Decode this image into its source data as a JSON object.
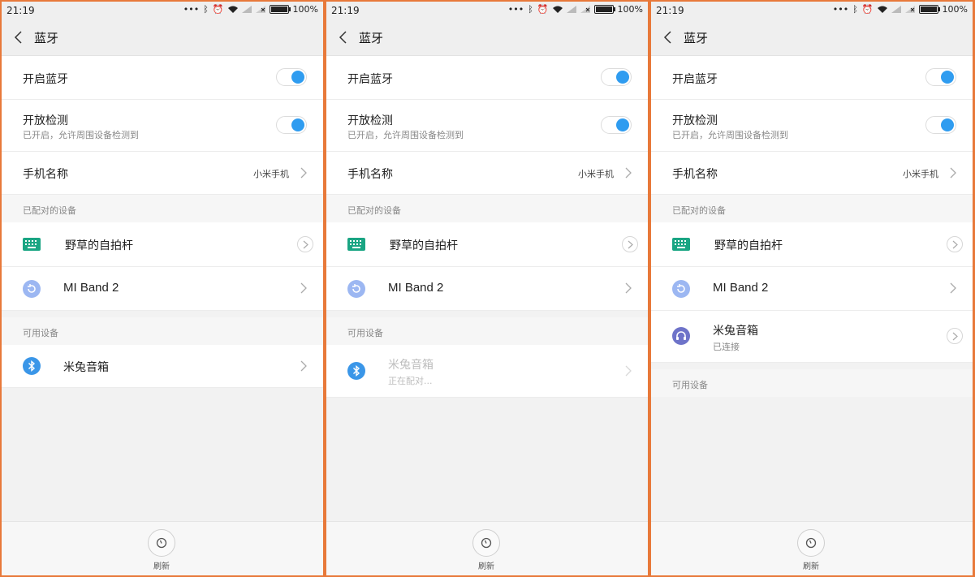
{
  "status": {
    "time": "21:19",
    "battery": "100%"
  },
  "title": "蓝牙",
  "settings": {
    "bluetooth_on_label": "开启蓝牙",
    "discoverable_label": "开放检测",
    "discoverable_sub": "已开启，允许周围设备检测到",
    "phone_name_label": "手机名称",
    "phone_name_value": "小米手机"
  },
  "sections": {
    "paired": "已配对的设备",
    "available": "可用设备"
  },
  "devices": {
    "selfie_stick": "野草的自拍杆",
    "mi_band": "MI Band 2",
    "speaker": "米兔音箱",
    "pairing_status": "正在配对...",
    "connected_status": "已连接"
  },
  "bottom": {
    "refresh_label": "刷新"
  },
  "colors": {
    "accent": "#2f9cf0",
    "keyboard_icon": "#1aa583",
    "miband_icon": "#9cb7f2",
    "bt_icon": "#3a96e8",
    "headphone_icon": "#6e73c9",
    "frame": "#e8793a"
  },
  "icons": [
    "back-arrow-icon",
    "keyboard-icon",
    "mi-band-icon",
    "bluetooth-icon",
    "headphone-icon",
    "refresh-icon",
    "chevron-right-icon"
  ]
}
